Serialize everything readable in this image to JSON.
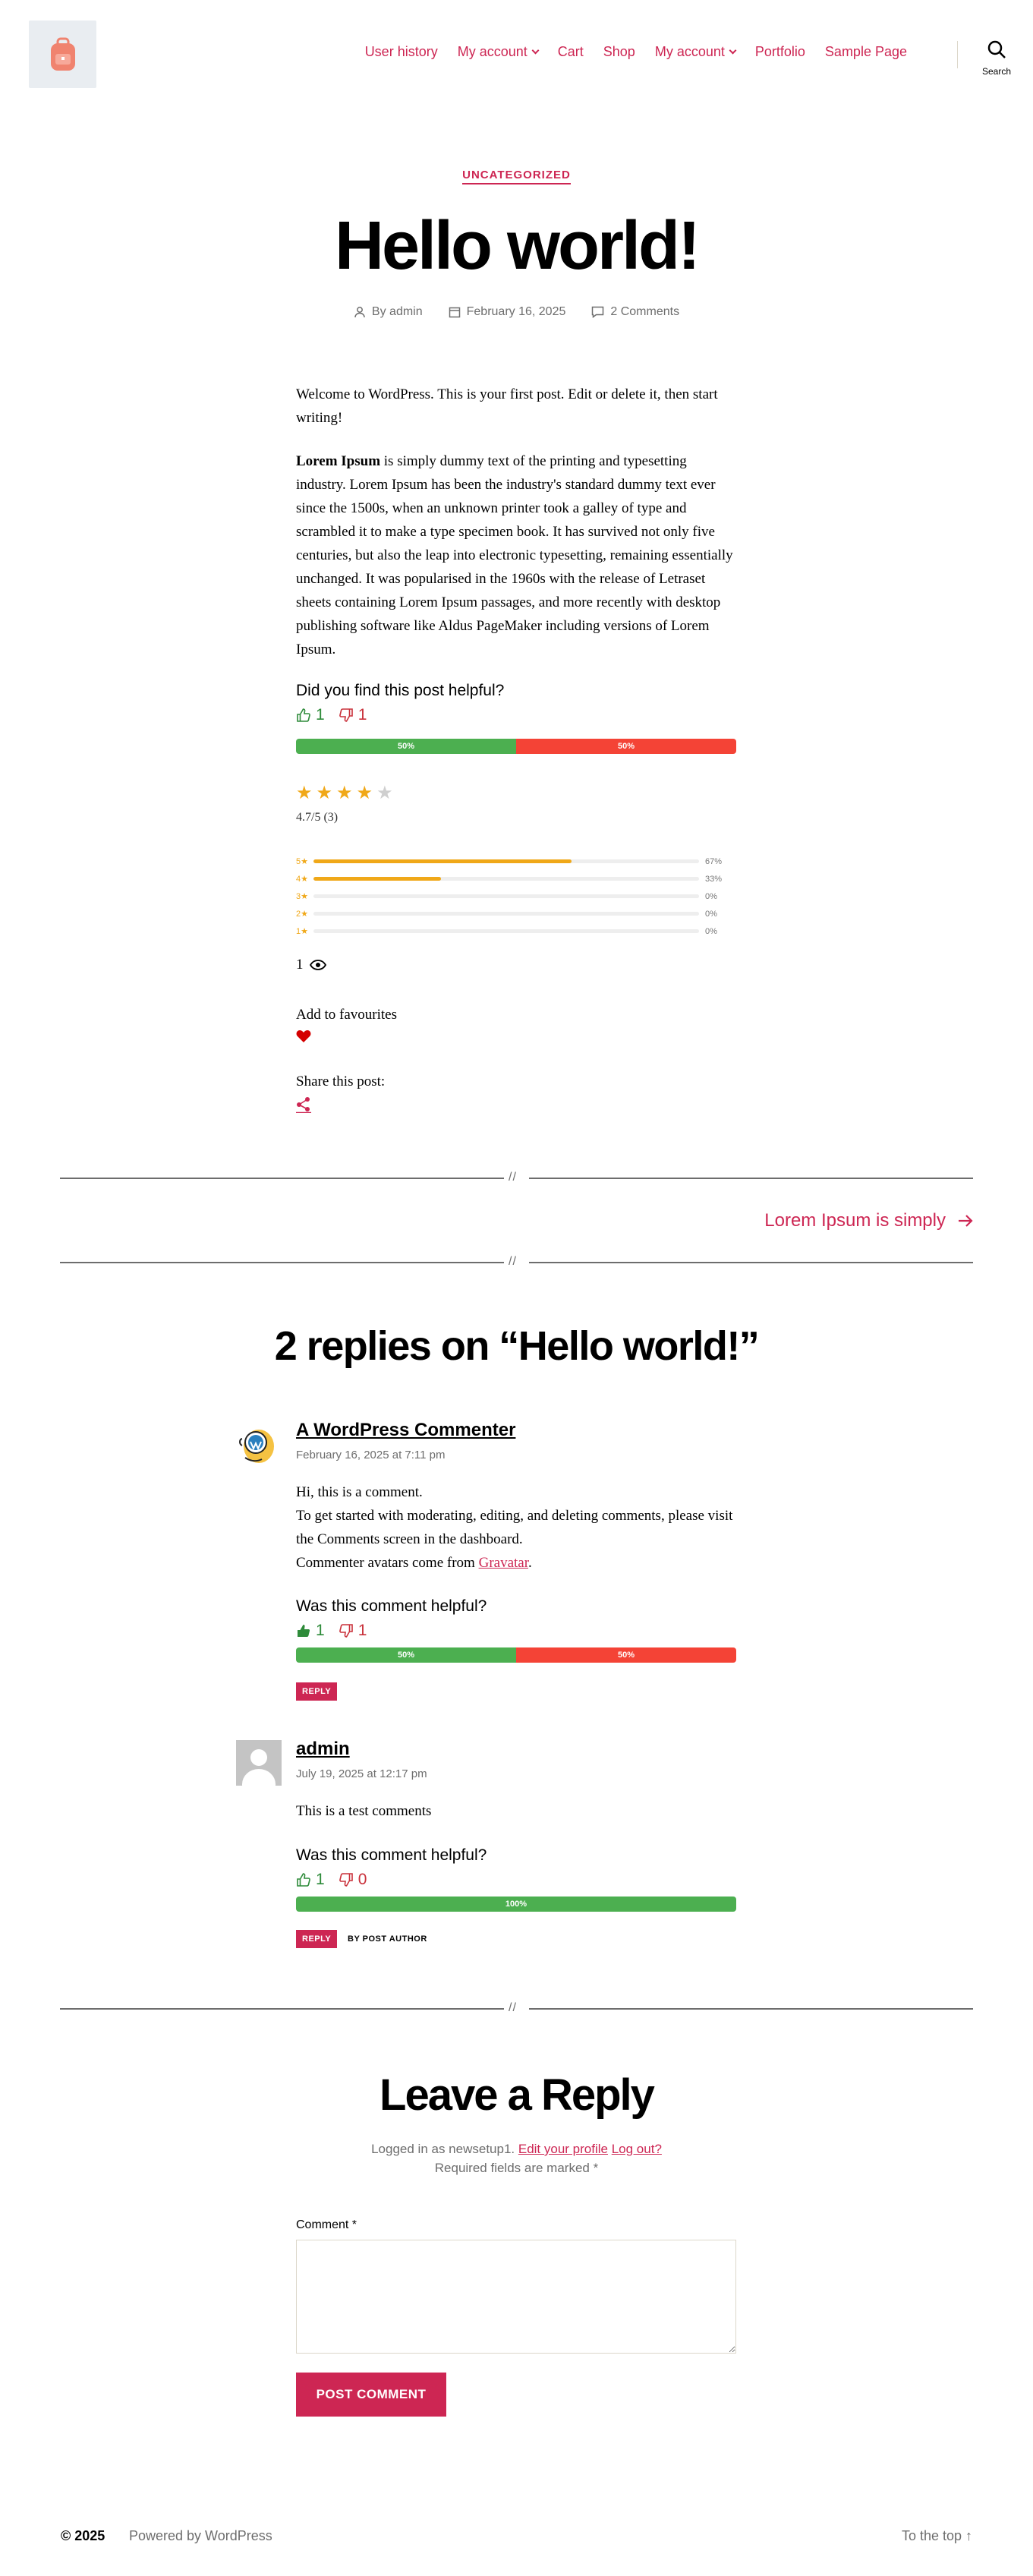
{
  "header": {
    "logo_icon": "backpack-icon",
    "nav": [
      "User history",
      "My account",
      "Cart",
      "Shop",
      "My account",
      "Portfolio",
      "Sample Page"
    ],
    "search_label": "Search"
  },
  "post": {
    "category": "UNCATEGORIZED",
    "title": "Hello world!",
    "author": "By admin",
    "date": "February 16, 2025",
    "comments_link": "2 Comments",
    "paragraph1": "Welcome to WordPress. This is your first post. Edit or delete it, then start writing!",
    "paragraph2_bold": "Lorem Ipsum",
    "paragraph2_rest": " is simply dummy text of the printing and typesetting industry. Lorem Ipsum has been the industry's standard dummy text ever since the 1500s, when an unknown printer took a galley of type and scrambled it to make a type specimen book. It has survived not only five centuries, but also the leap into electronic typesetting, remaining essentially unchanged. It was popularised in the 1960s with the release of Letraset sheets containing Lorem Ipsum passages, and more recently with desktop publishing software like Aldus PageMaker including versions of Lorem Ipsum."
  },
  "helpful": {
    "question": "Did you find this post helpful?",
    "up": "1",
    "down": "1",
    "up_pct": "50%",
    "down_pct": "50%"
  },
  "rating": {
    "stars_filled": 4,
    "stars_total": 5,
    "summary": "4.7/5 (3)",
    "rows": [
      {
        "label": "5★",
        "fraction": 0.67,
        "pct": "67%"
      },
      {
        "label": "4★",
        "fraction": 0.33,
        "pct": "33%"
      },
      {
        "label": "3★",
        "fraction": 0,
        "pct": "0%"
      },
      {
        "label": "2★",
        "fraction": 0,
        "pct": "0%"
      },
      {
        "label": "1★",
        "fraction": 0,
        "pct": "0%"
      }
    ]
  },
  "views": "1",
  "favourites_label": "Add to favourites",
  "share_label": "Share this post:",
  "separator_mark": "//",
  "next_post": "Lorem Ipsum is simply",
  "comments_title": "2 replies on “Hello world!”",
  "comment1": {
    "author": "A WordPress Commenter",
    "date": "February 16, 2025 at 7:11 pm",
    "line1": "Hi, this is a comment.",
    "line2": "To get started with moderating, editing, and deleting comments, please visit the Comments screen in the dashboard.",
    "line3": "Commenter avatars come from ",
    "line3_link": "Gravatar",
    "line3_end": ".",
    "question": "Was this comment helpful?",
    "up": "1",
    "down": "1",
    "up_pct": "50%",
    "down_pct": "50%",
    "reply": "REPLY"
  },
  "comment2": {
    "author": "admin",
    "date": "July 19, 2025 at 12:17 pm",
    "text": "This is a test comments",
    "question": "Was this comment helpful?",
    "up": "1",
    "down": "0",
    "up_pct": "100%",
    "reply": "REPLY",
    "badge": "BY POST AUTHOR"
  },
  "reply_form": {
    "title": "Leave a Reply",
    "logged_in": "Logged in as newsetup1. ",
    "edit_profile": "Edit your profile",
    "logout": "Log out?",
    "required": "Required fields are marked *",
    "comment_label": "Comment *",
    "submit": "POST COMMENT"
  },
  "footer": {
    "copyright": "© 2025",
    "powered": "Powered by WordPress",
    "to_top": "To the top ↑"
  },
  "colors": {
    "accent": "#cd2653",
    "vote_green": "#4caf50",
    "vote_red": "#f44336",
    "star": "#f0a818"
  }
}
